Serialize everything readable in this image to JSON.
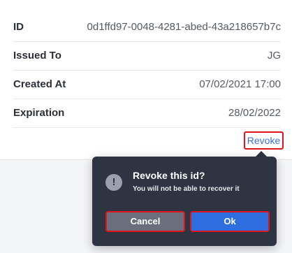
{
  "details": {
    "rows": [
      {
        "label": "ID",
        "value": "0d1ffd97-0048-4281-abed-43a218657b7c"
      },
      {
        "label": "Issued To",
        "value": "JG"
      },
      {
        "label": "Created At",
        "value": "07/02/2021 17:00"
      },
      {
        "label": "Expiration",
        "value": "28/02/2022"
      }
    ],
    "revoke_label": "Revoke"
  },
  "popover": {
    "icon": "exclamation-icon",
    "icon_glyph": "!",
    "title": "Revoke this id?",
    "message": "You will not be able to recover it",
    "cancel_label": "Cancel",
    "ok_label": "Ok"
  },
  "colors": {
    "link": "#3d6fd8",
    "popover_bg": "#2f3442",
    "ok_button": "#2f6ee0",
    "cancel_button": "#6a6f7e",
    "highlight_border": "#e0141b"
  }
}
